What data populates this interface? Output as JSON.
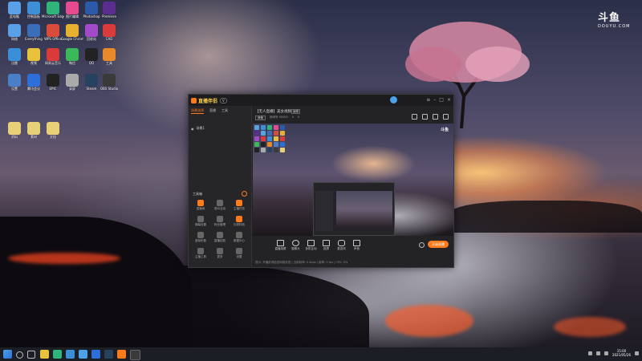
{
  "desktop": {
    "icons": [
      {
        "label": "此电脑",
        "color": "#5aa0e6"
      },
      {
        "label": "控制面板",
        "color": "#3d8fd8"
      },
      {
        "label": "Microsoft Edge",
        "color": "#2fb57a"
      },
      {
        "label": "图片编辑",
        "color": "#e54b8e"
      },
      {
        "label": "Photoshop",
        "color": "#2b5aa8"
      },
      {
        "label": "Premiere",
        "color": "#5b2d8e"
      },
      {
        "label": "网络",
        "color": "#5aa0e6"
      },
      {
        "label": "Everything",
        "color": "#3a6fb8"
      },
      {
        "label": "WPS Office",
        "color": "#d94b3a"
      },
      {
        "label": "Google Chrome",
        "color": "#e8b030"
      },
      {
        "label": "回收站",
        "color": "#a34ac9"
      },
      {
        "label": "CAD",
        "color": "#d93a3a"
      },
      {
        "label": "迅雷",
        "color": "#3a8fd8"
      },
      {
        "label": "视频",
        "color": "#e8c23a"
      },
      {
        "label": "网易云音乐",
        "color": "#d93a3a"
      },
      {
        "label": "微信",
        "color": "#3ab85a"
      },
      {
        "label": "QQ",
        "color": "#222222"
      },
      {
        "label": "工具",
        "color": "#e88a2a"
      },
      {
        "label": "设置",
        "color": "#4a7fc8"
      },
      {
        "label": "腾讯会议",
        "color": "#2d6fd8"
      },
      {
        "label": "EPIC",
        "color": "#222222"
      },
      {
        "label": "录屏",
        "color": "#aaaaaa"
      },
      {
        "label": "Steam",
        "color": "#27425f"
      },
      {
        "label": "OBS Studio",
        "color": "#3a3a3a"
      },
      {
        "label": "资料",
        "color": "#e8d078"
      },
      {
        "label": "素材",
        "color": "#e8d078"
      },
      {
        "label": "文档",
        "color": "#e8d078"
      }
    ],
    "watermark": {
      "cn": "斗鱼",
      "en": "DOUYU.COM"
    }
  },
  "app": {
    "name": "直播伴侣",
    "version": "V",
    "tabs": [
      {
        "label": "场景选择",
        "active": true
      },
      {
        "label": "直播",
        "active": false
      },
      {
        "label": "工具",
        "active": false
      }
    ],
    "scene": "场景1",
    "toolbox_title": "工具箱",
    "tools": [
      {
        "label": "直播间",
        "color": "#ff7a1a"
      },
      {
        "label": "观众互动",
        "color": "#666"
      },
      {
        "label": "主播任务",
        "color": "#ff7a1a"
      },
      {
        "label": "弹幕设置",
        "color": "#666"
      },
      {
        "label": "粉丝管理",
        "color": "#666"
      },
      {
        "label": "礼物特效",
        "color": "#ff7a1a"
      },
      {
        "label": "虚拟形象",
        "color": "#666"
      },
      {
        "label": "直播回放",
        "color": "#666"
      },
      {
        "label": "数据中心",
        "color": "#666"
      },
      {
        "label": "主播工具",
        "color": "#666"
      },
      {
        "label": "更多",
        "color": "#666"
      },
      {
        "label": "设置",
        "color": "#666"
      }
    ],
    "stream": {
      "title": "【无人直播】美女视频",
      "edit": "编辑",
      "category": "其他",
      "room": "房间号 00000",
      "viewers": "0",
      "likes": "0"
    },
    "preview_badge": "斗鱼",
    "controls": [
      "直播录屏",
      "摄像头",
      "多机互动",
      "投屏",
      "麦克风",
      "声音"
    ],
    "start_label": "开始直播",
    "status": "提示: 开播前请检查网络状态 | 当前码率: 0 kbps | 帧率: 0 fps | CPU: 0%"
  },
  "taskbar": {
    "time": "15:00",
    "date": "2021/05/26"
  }
}
